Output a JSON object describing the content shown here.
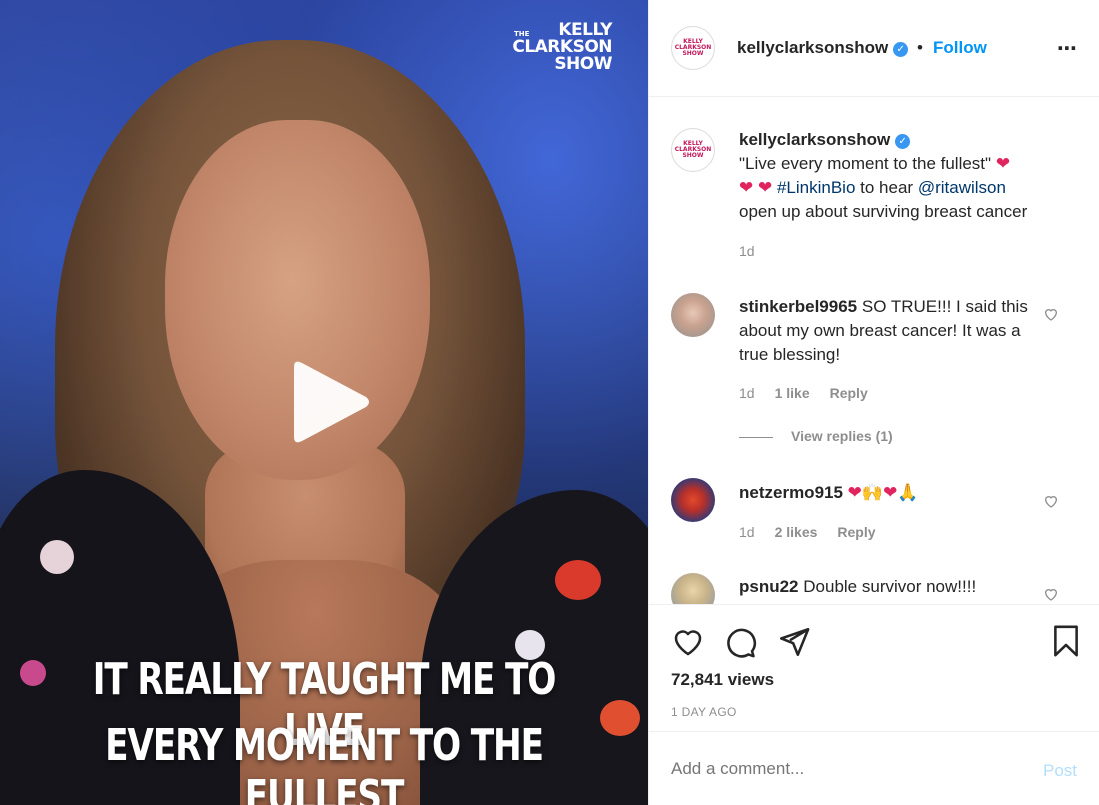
{
  "video": {
    "brand_small": "THE",
    "brand_line1": "KELLY",
    "brand_line2": "CLARKSON",
    "brand_line3": "SHOW",
    "caption_line1": "IT REALLY TAUGHT ME TO LIVE",
    "caption_line2": "EVERY MOMENT TO THE FULLEST",
    "play_icon": "play-icon"
  },
  "header": {
    "username": "kellyclarksonshow",
    "dot": "•",
    "follow_label": "Follow",
    "more_icon": "⋯"
  },
  "caption": {
    "username": "kellyclarksonshow",
    "text_part1": "\"Live every moment to the fullest\"",
    "hashtag": "#LinkinBio",
    "text_part2": "to hear",
    "mention": "@ritawilson",
    "text_part3": "open up about surviving breast cancer",
    "time": "1d"
  },
  "comments": [
    {
      "username": "stinkerbel9965",
      "text": "SO TRUE!!! I said this about my own breast cancer! It was a true blessing!",
      "time": "1d",
      "likes": "1 like",
      "reply": "Reply",
      "view_replies": "View replies (1)"
    },
    {
      "username": "netzermo915",
      "text": "❤🙌❤🙏",
      "time": "1d",
      "likes": "2 likes",
      "reply": "Reply"
    },
    {
      "username": "psnu22",
      "text": "Double survivor now!!!!"
    }
  ],
  "stats": {
    "views": "72,841 views",
    "posted": "1 DAY AGO"
  },
  "add_comment": {
    "placeholder": "Add a comment...",
    "post_label": "Post"
  },
  "colors": {
    "accent": "#0095f6",
    "link": "#00376b",
    "muted": "#8e8e8e",
    "post_disabled": "#b2dffc",
    "heart": "#e0245e"
  }
}
